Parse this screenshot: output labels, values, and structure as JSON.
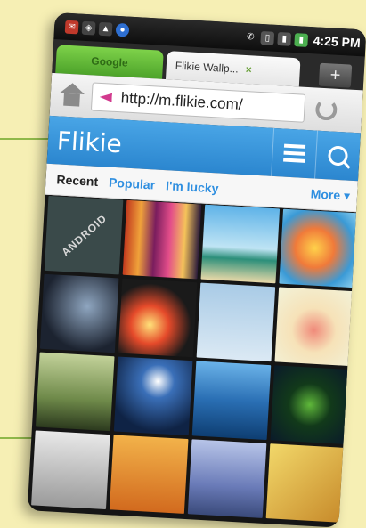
{
  "statusbar": {
    "time": "4:25 PM",
    "icons": [
      "gmail-icon",
      "wifi-icon",
      "warning-icon",
      "app-icon",
      "phone-icon",
      "sd-card-icon",
      "signal-icon",
      "battery-icon"
    ]
  },
  "browser": {
    "tabs": [
      {
        "label": "Google"
      },
      {
        "label": "Flikie Wallp...",
        "close": "×"
      }
    ],
    "new_tab": "+",
    "url": "http://m.flikie.com/"
  },
  "site": {
    "brand": "Flikie",
    "nav": [
      {
        "label": "Recent"
      },
      {
        "label": "Popular"
      },
      {
        "label": "I'm lucky"
      },
      {
        "label": "More ▾"
      }
    ]
  },
  "colors": {
    "header": "#2b86cf",
    "accent_link": "#2f8fe0",
    "tab_green": "#4da32a",
    "background": "#f6efb4"
  },
  "wallpapers": [
    {
      "label": "ANDROID"
    },
    {
      "label": ""
    },
    {
      "label": ""
    },
    {
      "label": ""
    },
    {
      "label": ""
    },
    {
      "label": ""
    },
    {
      "label": ""
    },
    {
      "label": ""
    },
    {
      "label": ""
    },
    {
      "label": ""
    },
    {
      "label": ""
    },
    {
      "label": ""
    },
    {
      "label": ""
    },
    {
      "label": ""
    },
    {
      "label": ""
    },
    {
      "label": ""
    }
  ]
}
